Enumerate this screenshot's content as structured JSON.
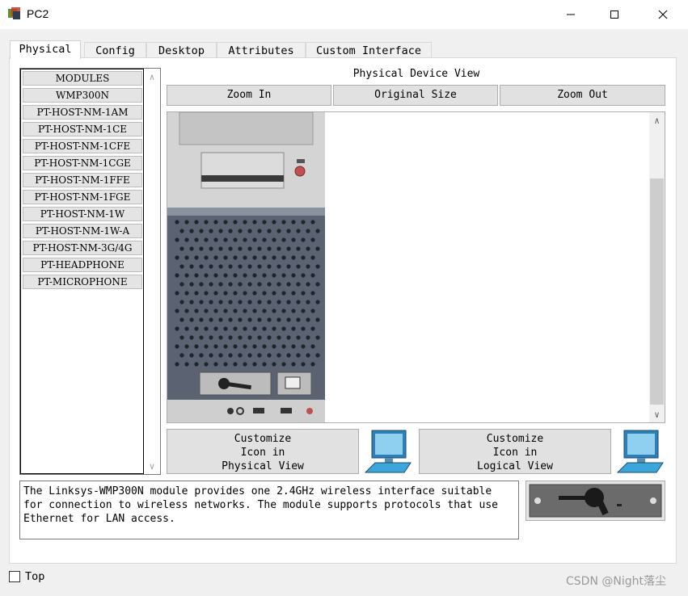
{
  "window": {
    "title": "PC2",
    "minimize_glyph": "—",
    "maximize_glyph": "☐",
    "close_glyph": "✕"
  },
  "tabs": [
    {
      "label": "Physical",
      "active": true
    },
    {
      "label": "Config",
      "active": false
    },
    {
      "label": "Desktop",
      "active": false
    },
    {
      "label": "Attributes",
      "active": false
    },
    {
      "label": "Custom Interface",
      "active": false
    }
  ],
  "modules": {
    "items": [
      "MODULES",
      "WMP300N",
      "PT-HOST-NM-1AM",
      "PT-HOST-NM-1CE",
      "PT-HOST-NM-1CFE",
      "PT-HOST-NM-1CGE",
      "PT-HOST-NM-1FFE",
      "PT-HOST-NM-1FGE",
      "PT-HOST-NM-1W",
      "PT-HOST-NM-1W-A",
      "PT-HOST-NM-3G/4G",
      "PT-HEADPHONE",
      "PT-MICROPHONE"
    ]
  },
  "device_view": {
    "title": "Physical Device View",
    "zoom_in": "Zoom In",
    "original_size": "Original Size",
    "zoom_out": "Zoom Out"
  },
  "customize": {
    "physical": "Customize\nIcon in\nPhysical View",
    "logical": "Customize\nIcon in\nLogical View"
  },
  "description": "The Linksys-WMP300N module provides one 2.4GHz wireless interface suitable for connection to wireless networks. The module supports protocols that use Ethernet for LAN access.",
  "footer": {
    "top_label": "Top",
    "top_checked": false,
    "watermark": "CSDN @Night落尘"
  },
  "colors": {
    "case_light": "#c8c8c8",
    "case_dark": "#5b6372",
    "monitor_blue": "#3aa6d9"
  }
}
